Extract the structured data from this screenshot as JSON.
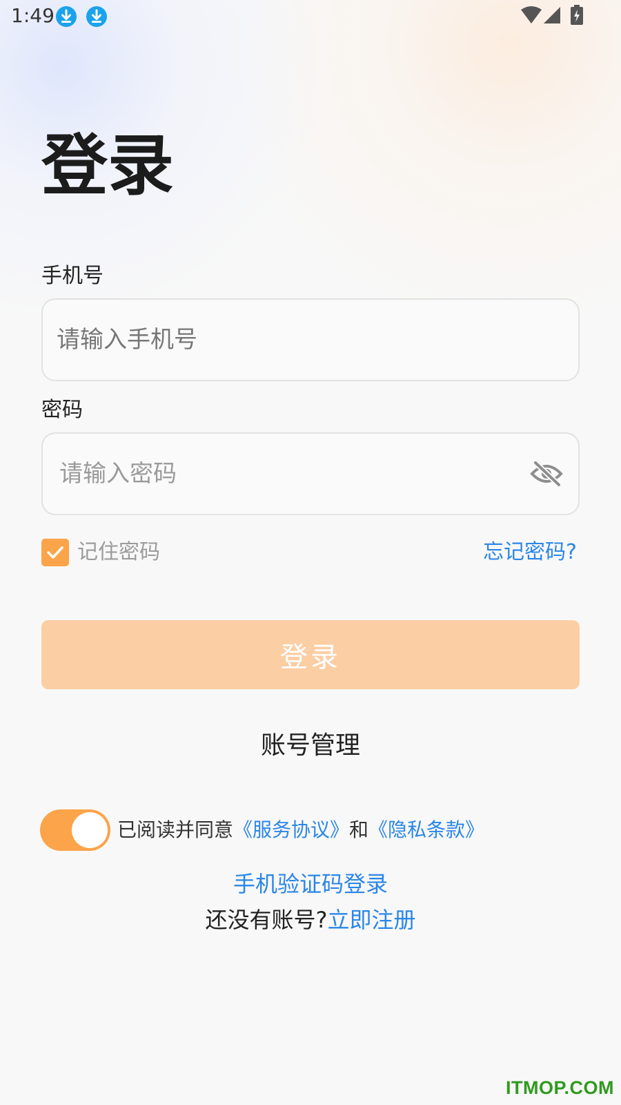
{
  "status_bar": {
    "time": "1:49",
    "icons": [
      "download-icon",
      "download-icon",
      "wifi-icon",
      "signal-icon",
      "battery-charging-icon"
    ]
  },
  "page": {
    "title": "登录"
  },
  "phone_field": {
    "label": "手机号",
    "value": "",
    "placeholder": "请输入手机号"
  },
  "password_field": {
    "label": "密码",
    "value": "",
    "placeholder": "请输入密码",
    "toggle_icon": "eye-off-icon"
  },
  "remember": {
    "label": "记住密码",
    "checked": true
  },
  "forgot_link": "忘记密码?",
  "login_button": "登录",
  "account_manage": "账号管理",
  "agreement": {
    "enabled": true,
    "prefix": "已阅读并同意",
    "service_link": "《服务协议》",
    "conjunction": "和",
    "privacy_link": "《隐私条款》"
  },
  "sms_login_link": "手机验证码登录",
  "register": {
    "prompt": "还没有账号?",
    "link": "立即注册"
  },
  "watermark": "ITMOP.COM",
  "colors": {
    "accent_orange": "#fba44a",
    "button_disabled": "#fbcea4",
    "link_blue": "#2a86e8",
    "text_dark": "#1c1c1c",
    "watermark_green": "#2f9a1e",
    "download_blue": "#1aa3ec"
  }
}
